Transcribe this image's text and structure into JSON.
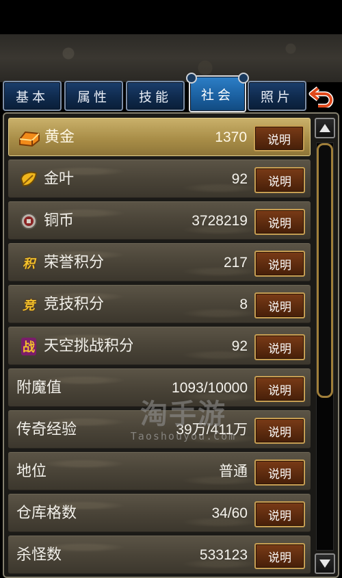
{
  "tabs": [
    {
      "label": "基本",
      "active": false
    },
    {
      "label": "属性",
      "active": false
    },
    {
      "label": "技能",
      "active": false
    },
    {
      "label": "社会",
      "active": true
    },
    {
      "label": "照片",
      "active": false
    }
  ],
  "rows": [
    {
      "label": "黄金",
      "value": "1370",
      "button": "说明",
      "icon": "gold-ingot-icon",
      "highlighted": true
    },
    {
      "label": "金叶",
      "value": "92",
      "button": "说明",
      "icon": "gold-leaf-icon"
    },
    {
      "label": "铜币",
      "value": "3728219",
      "button": "说明",
      "icon": "copper-coin-icon"
    },
    {
      "label": "荣誉积分",
      "value": "217",
      "button": "说明",
      "icon": "honor-points-icon",
      "icon_glyph": "积"
    },
    {
      "label": "竞技积分",
      "value": "8",
      "button": "说明",
      "icon": "arena-points-icon",
      "icon_glyph": "竞"
    },
    {
      "label": "天空挑战积分",
      "value": "92",
      "button": "说明",
      "icon": "sky-challenge-icon",
      "icon_glyph": "战"
    },
    {
      "label": "附魔值",
      "value": "1093/10000",
      "button": "说明"
    },
    {
      "label": "传奇经验",
      "value": "39万/411万",
      "button": "说明"
    },
    {
      "label": "地位",
      "value": "普通",
      "button": "说明"
    },
    {
      "label": "仓库格数",
      "value": "34/60",
      "button": "说明"
    },
    {
      "label": "杀怪数",
      "value": "533123",
      "button": "说明"
    }
  ],
  "watermark": {
    "main": "淘手游",
    "sub": "Taoshouyou.Com"
  },
  "colors": {
    "tab_active": "#1a5f9f",
    "tab": "#0f2a4d",
    "highlight": "#a98e48",
    "button": "#5b2a0e",
    "button_border": "#c79e52"
  }
}
